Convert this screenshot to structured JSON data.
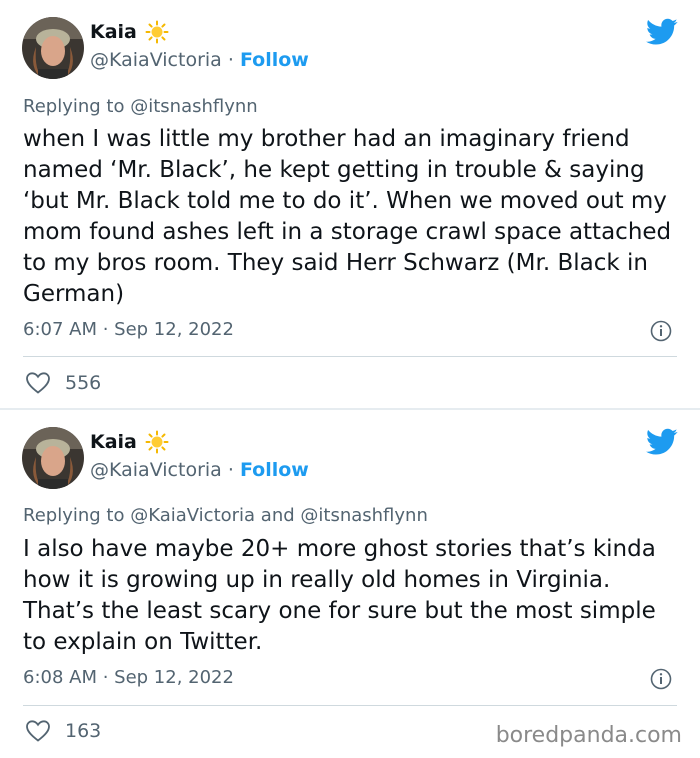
{
  "tweets": [
    {
      "author_name": "Kaia",
      "handle": "@KaiaVictoria",
      "separator": "·",
      "follow_label": "Follow",
      "reply_prefix": "Replying to",
      "reply_targets": "@itsnashflynn",
      "body": "when I was little my brother had an imaginary friend named ‘Mr. Black’, he kept getting in trouble & saying ‘but Mr. Black told me to do it’. When we moved out my mom found ashes left in a storage crawl space attached to my bros room. They said Herr Schwarz (Mr. Black in German)",
      "time": "6:07 AM · Sep 12, 2022",
      "likes": "556"
    },
    {
      "author_name": "Kaia",
      "handle": "@KaiaVictoria",
      "separator": "·",
      "follow_label": "Follow",
      "reply_prefix": "Replying to",
      "reply_targets": "@KaiaVictoria and @itsnashflynn",
      "body": "I also have maybe 20+ more ghost stories that’s kinda how it is growing up in really old homes in Virginia. That’s the least scary one for sure but the most simple to explain on Twitter.",
      "time": "6:08 AM · Sep 12, 2022",
      "likes": "163"
    }
  ],
  "watermark": "boredpanda.com",
  "colors": {
    "accent": "#1d9bf0",
    "muted": "#536471",
    "text": "#0f1419"
  },
  "icons": [
    "sun-emoji-icon",
    "twitter-bird-icon",
    "info-icon",
    "heart-icon"
  ]
}
